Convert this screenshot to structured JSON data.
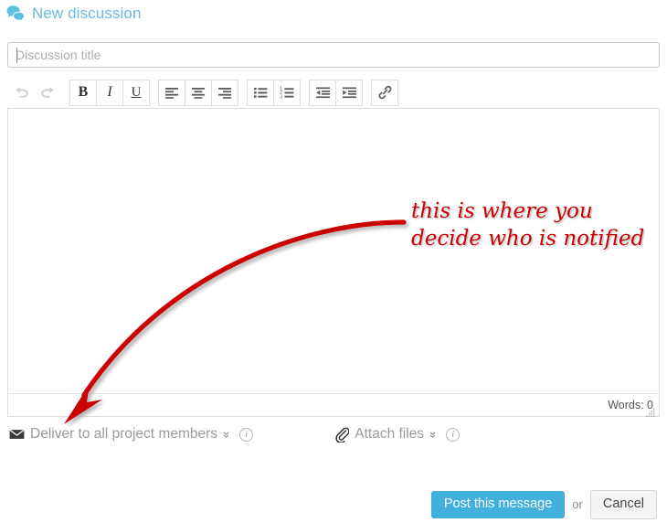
{
  "header": {
    "title": "New discussion",
    "icon": "speech-bubbles-icon",
    "color": "#6bb9e0"
  },
  "title_field": {
    "placeholder": "Discussion title",
    "value": ""
  },
  "toolbar": {
    "buttons": [
      {
        "name": "undo",
        "label": "↶",
        "disabled": true
      },
      {
        "name": "redo",
        "label": "↷",
        "disabled": true
      },
      {
        "name": "bold",
        "label": "B"
      },
      {
        "name": "italic",
        "label": "I"
      },
      {
        "name": "underline",
        "label": "U"
      },
      {
        "name": "align-left",
        "label": ""
      },
      {
        "name": "align-center",
        "label": ""
      },
      {
        "name": "align-right",
        "label": ""
      },
      {
        "name": "bulleted-list",
        "label": ""
      },
      {
        "name": "numbered-list",
        "label": ""
      },
      {
        "name": "outdent",
        "label": ""
      },
      {
        "name": "indent",
        "label": ""
      },
      {
        "name": "link",
        "label": ""
      }
    ]
  },
  "editor": {
    "content": "",
    "word_count_label": "Words: 0"
  },
  "options": {
    "deliver": {
      "label": "Deliver to all project members",
      "chevron": "»",
      "info": "i",
      "icon": "envelope-icon"
    },
    "attach": {
      "label": "Attach files",
      "chevron": "»",
      "info": "i",
      "icon": "paperclip-icon"
    }
  },
  "footer": {
    "post_label": "Post this message",
    "or_label": "or",
    "cancel_label": "Cancel",
    "post_color": "#41b0dd"
  },
  "annotation": {
    "line1": "this is where you",
    "line2": "decide who is notified",
    "color": "#cc0000",
    "arrow": "curved-arrow-pointing-to-deliver-option"
  }
}
